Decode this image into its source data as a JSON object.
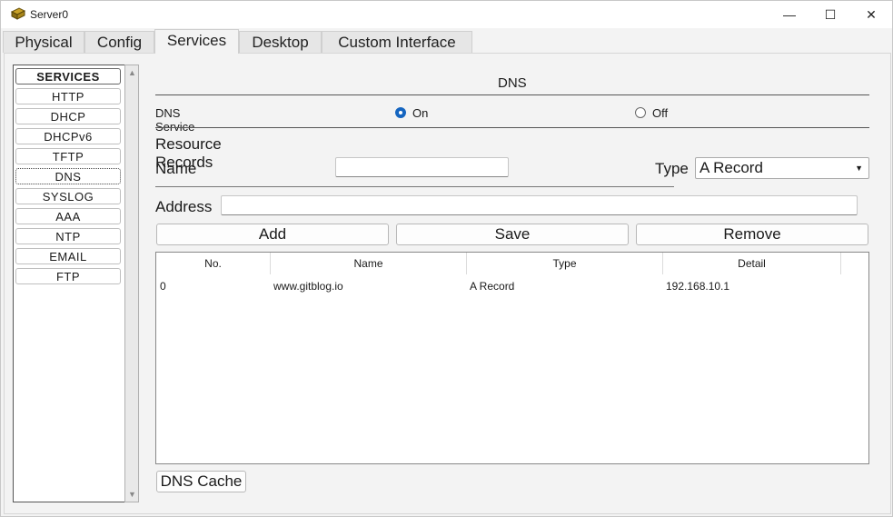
{
  "window": {
    "title": "Server0",
    "minimize_glyph": "—",
    "maximize_glyph": "☐",
    "close_glyph": "✕"
  },
  "tabs": [
    {
      "label": "Physical"
    },
    {
      "label": "Config"
    },
    {
      "label": "Services"
    },
    {
      "label": "Desktop"
    },
    {
      "label": "Custom Interface"
    }
  ],
  "active_tab": "Services",
  "services": {
    "header": "SERVICES",
    "items": [
      "HTTP",
      "DHCP",
      "DHCPv6",
      "TFTP",
      "DNS",
      "SYSLOG",
      "AAA",
      "NTP",
      "EMAIL",
      "FTP"
    ],
    "selected": "DNS"
  },
  "dns": {
    "section_title": "DNS",
    "service_label": "DNS Service",
    "on_label": "On",
    "off_label": "Off",
    "service_state": "on",
    "resource_records_label": "Resource Records",
    "name_label": "Name",
    "name_value": "",
    "type_label": "Type",
    "type_value": "A Record",
    "address_label": "Address",
    "address_value": "",
    "add_label": "Add",
    "save_label": "Save",
    "remove_label": "Remove",
    "table": {
      "columns": [
        "No.",
        "Name",
        "Type",
        "Detail"
      ],
      "rows": [
        [
          "0",
          "www.gitblog.io",
          "A Record",
          "192.168.10.1"
        ]
      ]
    },
    "dns_cache_label": "DNS Cache"
  },
  "colors": {
    "radio_selected": "#1565c0",
    "window_bg": "#f3f3f3"
  }
}
